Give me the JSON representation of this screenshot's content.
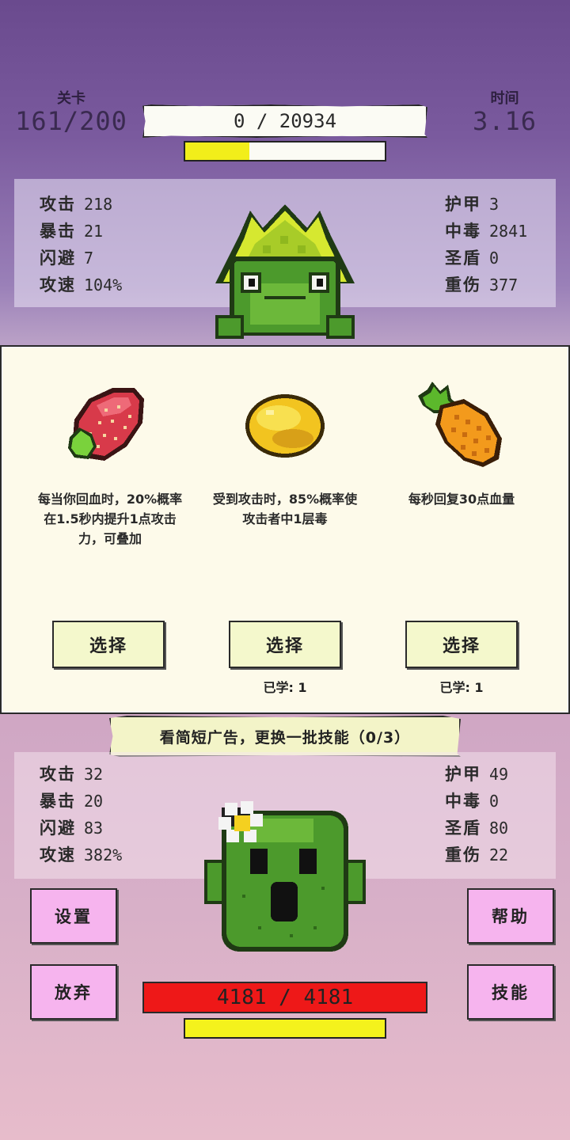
{
  "header": {
    "level_label": "关卡",
    "level_value": "161/200",
    "time_label": "时间",
    "time_value": "3.16",
    "enemy_hp_text": "0 / 20934",
    "enemy_progress": 0.32
  },
  "enemy_stats": {
    "left": [
      {
        "name": "攻击",
        "value": "218"
      },
      {
        "name": "暴击",
        "value": "21"
      },
      {
        "name": "闪避",
        "value": "7"
      },
      {
        "name": "攻速",
        "value": "104%"
      }
    ],
    "right": [
      {
        "name": "护甲",
        "value": "3"
      },
      {
        "name": "中毒",
        "value": "2841"
      },
      {
        "name": "圣盾",
        "value": "0"
      },
      {
        "name": "重伤",
        "value": "377"
      }
    ]
  },
  "skills": [
    {
      "icon": "strawberry-icon",
      "desc": "每当你回血时，20%概率在1.5秒内提升1点攻击力，可叠加",
      "button": "选择",
      "learned": ""
    },
    {
      "icon": "lemon-icon",
      "desc": "受到攻击时，85%概率使攻击者中1层毒",
      "button": "选择",
      "learned": "已学: 1"
    },
    {
      "icon": "pineapple-icon",
      "desc": "每秒回复30点血量",
      "button": "选择",
      "learned": "已学: 1"
    }
  ],
  "ad_banner": "看简短广告，更换一批技能（0/3）",
  "player_stats": {
    "left": [
      {
        "name": "攻击",
        "value": "32"
      },
      {
        "name": "暴击",
        "value": "20"
      },
      {
        "name": "闪避",
        "value": "83"
      },
      {
        "name": "攻速",
        "value": "382%"
      }
    ],
    "right": [
      {
        "name": "护甲",
        "value": "49"
      },
      {
        "name": "中毒",
        "value": "0"
      },
      {
        "name": "圣盾",
        "value": "80"
      },
      {
        "name": "重伤",
        "value": "22"
      }
    ]
  },
  "buttons": {
    "settings": "设置",
    "give_up": "放弃",
    "help": "帮助",
    "skills": "技能"
  },
  "player_hp_text": "4181 / 4181",
  "player_energy": 1.0,
  "colors": {
    "hp_red": "#ee1818",
    "energy_yellow": "#f4f21c",
    "pink_button": "#f6b4ee"
  }
}
